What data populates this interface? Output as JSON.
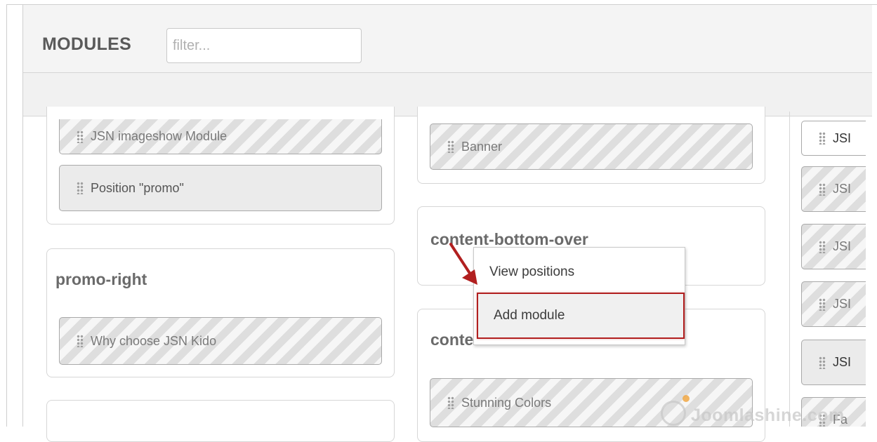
{
  "header": {
    "title": "MODULES",
    "filter_placeholder": "filter..."
  },
  "column1": {
    "panel_top_modules": [
      "JSN imageshow Module",
      "Position \"promo\""
    ],
    "promo_right": {
      "title": "promo-right",
      "modules": [
        "Why choose JSN Kido"
      ]
    }
  },
  "column2": {
    "panel_top_modules": [
      "Banner"
    ],
    "content_bottom_over": {
      "title": "content-bottom-over"
    },
    "content_bottom": {
      "title": "content-bottom",
      "modules": [
        "Stunning Colors"
      ]
    }
  },
  "column3": {
    "modules": [
      "JSI",
      "JSI",
      "JSI",
      "JSI",
      "JSI",
      "Fa"
    ]
  },
  "context_menu": {
    "items": [
      "View positions",
      "Add module"
    ],
    "highlighted_item": "Add module"
  },
  "watermark": {
    "text": "Joomlashine.com"
  },
  "colors": {
    "highlight_border": "#b11f1f",
    "arrow": "#b11f1f",
    "title_gray": "#5a5a5a"
  },
  "icons": {
    "grip": "grip-dots-icon",
    "arrow": "red-arrow-icon",
    "watermark_logo": "joomlashine-logo-icon"
  }
}
